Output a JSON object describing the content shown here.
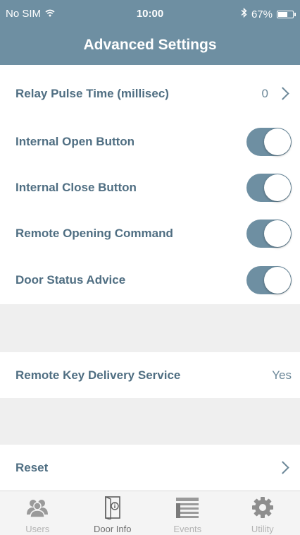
{
  "status_bar": {
    "carrier": "No SIM",
    "time": "10:00",
    "battery": "67%",
    "battery_level": 0.67
  },
  "header": {
    "title": "Advanced Settings"
  },
  "settings": {
    "relay_pulse": {
      "label": "Relay Pulse Time (millisec)",
      "value": "0"
    },
    "internal_open": {
      "label": "Internal Open Button",
      "on": true
    },
    "internal_close": {
      "label": "Internal Close Button",
      "on": true
    },
    "remote_opening": {
      "label": "Remote Opening Command",
      "on": true
    },
    "door_status": {
      "label": "Door Status Advice",
      "on": true
    },
    "remote_key": {
      "label": "Remote Key Delivery Service",
      "value": "Yes"
    },
    "reset": {
      "label": "Reset"
    }
  },
  "tabbar": {
    "tabs": [
      {
        "label": "Users",
        "icon": "users-icon"
      },
      {
        "label": "Door Info",
        "icon": "door-info-icon",
        "active": true
      },
      {
        "label": "Events",
        "icon": "events-icon"
      },
      {
        "label": "Utility",
        "icon": "gear-icon"
      }
    ]
  },
  "colors": {
    "accent": "#6e8fa2",
    "label_text": "#4f6e82",
    "section_gap": "#efefef"
  }
}
